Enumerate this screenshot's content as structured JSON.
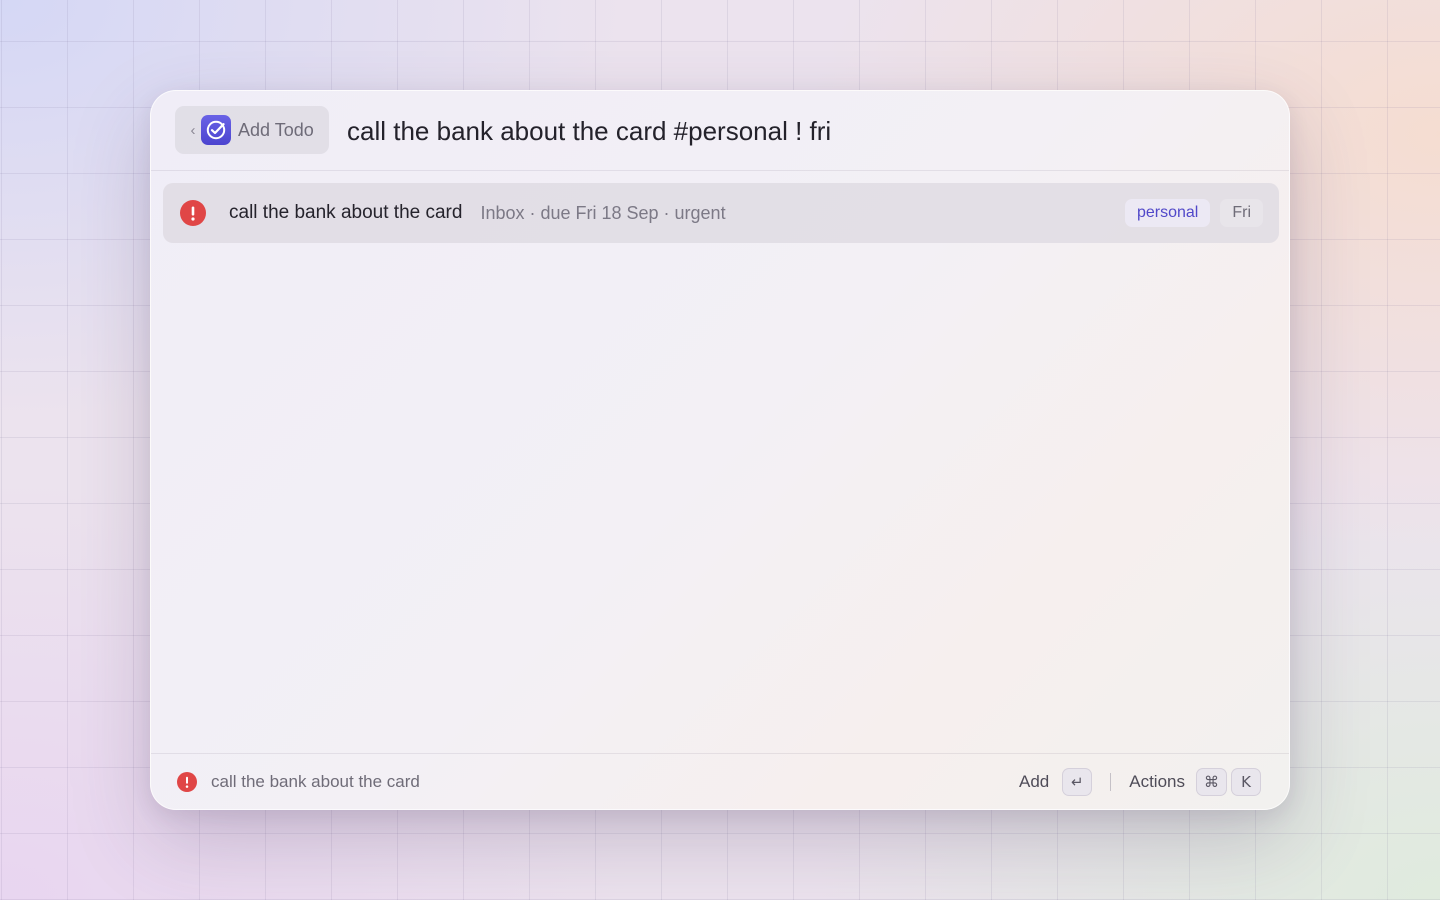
{
  "header": {
    "back_chip": {
      "chevron": "‹",
      "app_icon": "todo-check-icon",
      "label": "Add Todo"
    },
    "query": {
      "value": "call the bank about the card #personal ! fri",
      "placeholder": ""
    }
  },
  "results": [
    {
      "icon": "urgent-exclamation-icon",
      "title": "call the bank about the card",
      "meta": "Inbox · due Fri 18 Sep · urgent",
      "tags": {
        "project": "personal",
        "due": "Fri"
      }
    }
  ],
  "footer": {
    "icon": "urgent-exclamation-icon",
    "title": "call the bank about the card",
    "primary_action": {
      "label": "Add",
      "key": "↵"
    },
    "actions": {
      "label": "Actions",
      "keys": [
        "⌘",
        "K"
      ]
    }
  },
  "colors": {
    "accent": "#5148c9",
    "app_icon": "#5b54dc",
    "urgent": "#e04646"
  }
}
